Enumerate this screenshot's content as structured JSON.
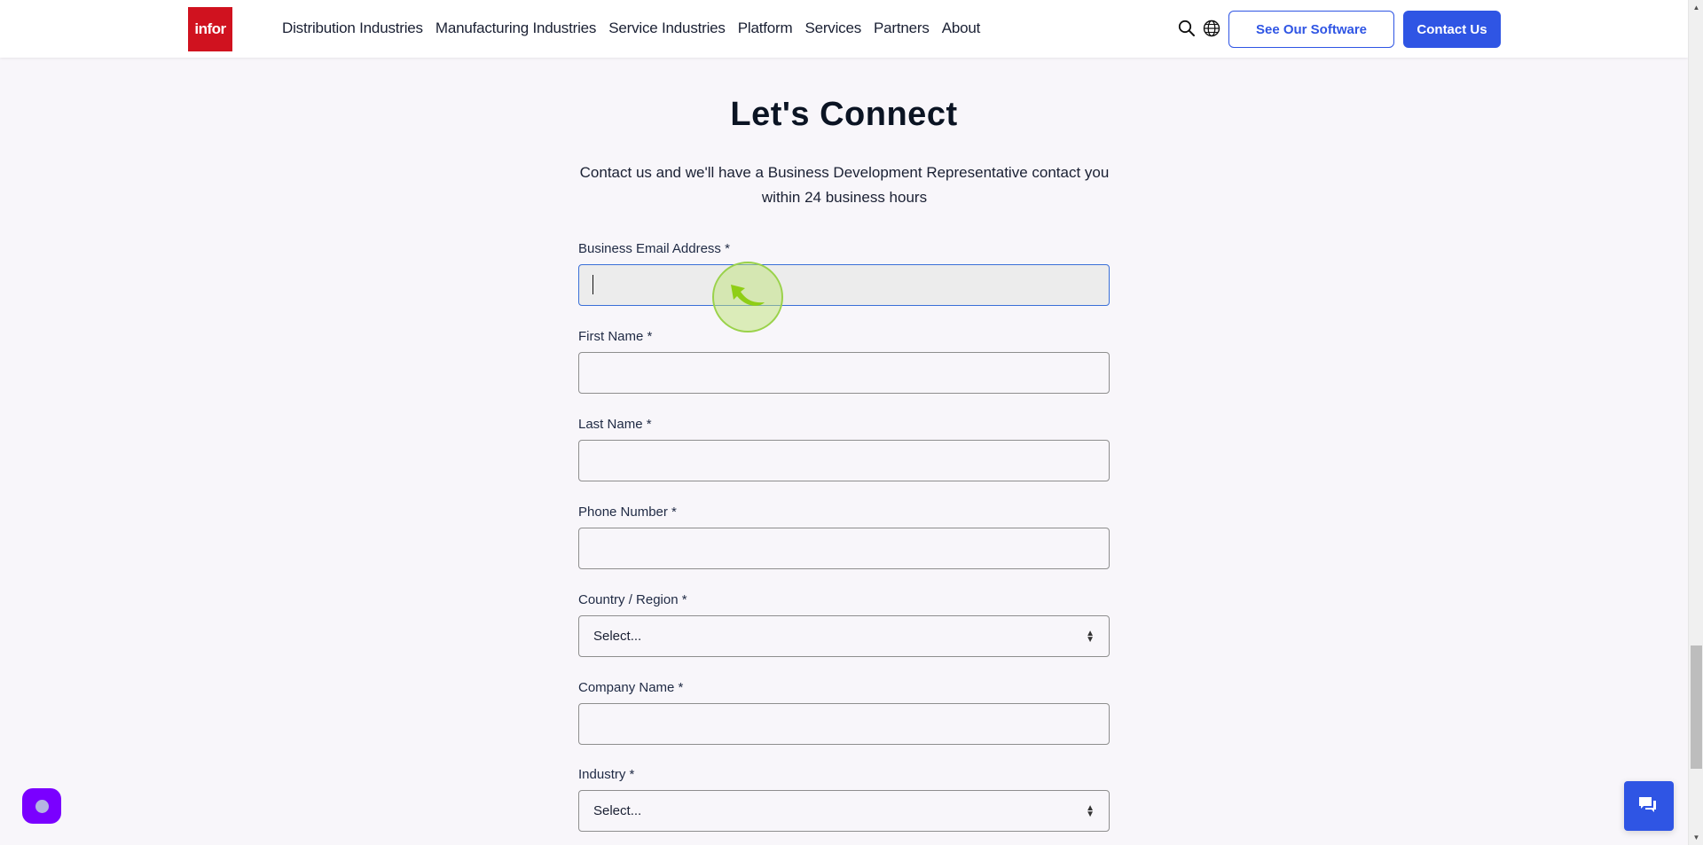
{
  "header": {
    "logo_text": "infor",
    "nav": [
      {
        "label": "Distribution Industries"
      },
      {
        "label": "Manufacturing Industries"
      },
      {
        "label": "Service Industries"
      },
      {
        "label": "Platform"
      },
      {
        "label": "Services"
      },
      {
        "label": "Partners"
      },
      {
        "label": "About"
      }
    ],
    "search_icon": "search-icon",
    "language_icon": "globe-icon",
    "see_software_label": "See Our Software",
    "contact_label": "Contact Us"
  },
  "main": {
    "title": "Let's Connect",
    "subtitle": "Contact us and we'll have a Business Development Representative contact you within 24 business hours",
    "form": {
      "email": {
        "label": "Business Email Address *",
        "value": "",
        "placeholder": ""
      },
      "first_name": {
        "label": "First Name *",
        "value": "",
        "placeholder": ""
      },
      "last_name": {
        "label": "Last Name *",
        "value": "",
        "placeholder": ""
      },
      "phone": {
        "label": "Phone Number *",
        "value": "",
        "placeholder": ""
      },
      "country": {
        "label": "Country / Region *",
        "selected": "Select..."
      },
      "company": {
        "label": "Company Name *",
        "value": "",
        "placeholder": ""
      },
      "industry": {
        "label": "Industry *",
        "selected": "Select..."
      }
    }
  },
  "widgets": {
    "left_widget_icon": "assistant-dot-icon",
    "chat_icon": "chat-bubbles-icon"
  },
  "colors": {
    "brand_red": "#d0121f",
    "accent_blue": "#2f55e4",
    "focus_blue": "#3a6fd8",
    "widget_purple": "#7a00ff",
    "background": "#f8f6fa"
  }
}
